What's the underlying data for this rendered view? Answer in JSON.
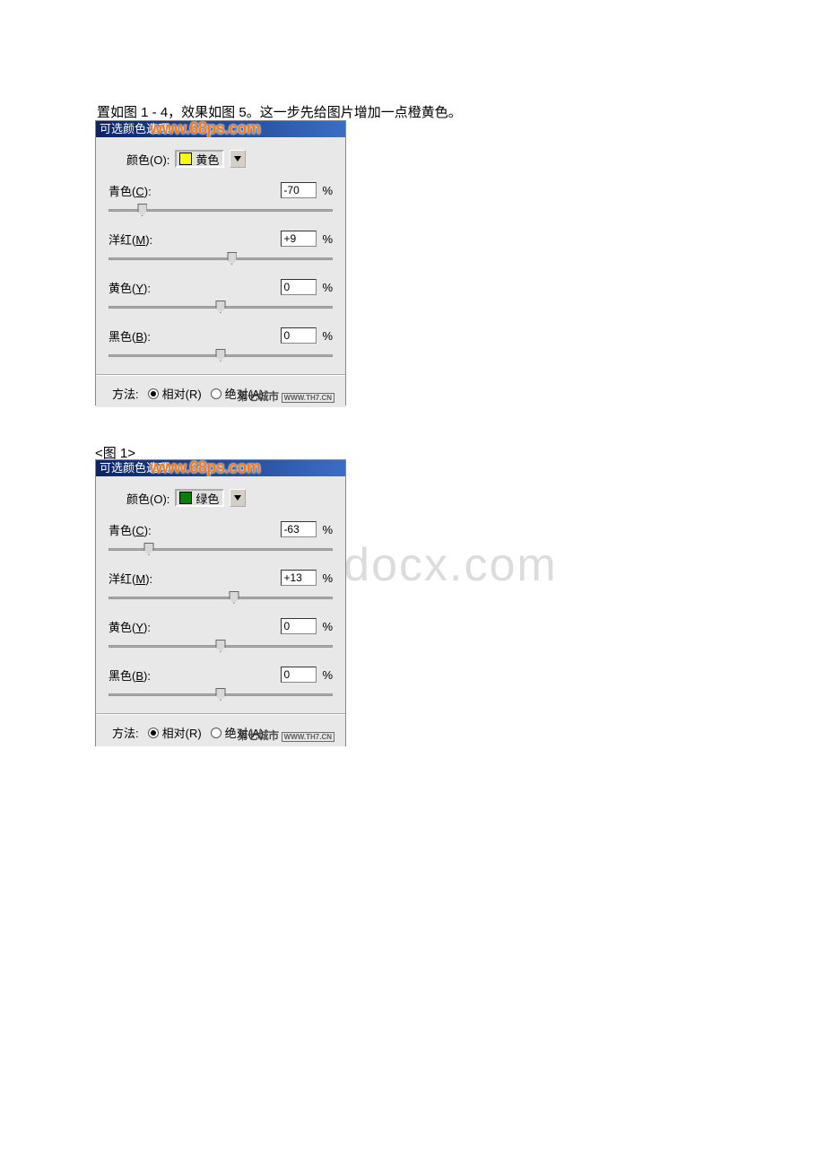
{
  "caption_top": "置如图 1 - 4，效果如图 5。这一步先给图片增加一点橙黄色。",
  "figure_label": "<图 1>",
  "bg_watermark": "www.bdocx.com",
  "panels": [
    {
      "title": "可选颜色选项",
      "wm_overlay": "www.68ps.com",
      "color_label": "颜色(O):",
      "color_letter": "O",
      "selected_color": "黄色",
      "swatch_class": "yellow",
      "sliders": [
        {
          "label": "青色",
          "letter": "C",
          "value": "-70",
          "pct": "%",
          "pos": 15
        },
        {
          "label": "洋红",
          "letter": "M",
          "value": "+9",
          "pct": "%",
          "pos": 55
        },
        {
          "label": "黄色",
          "letter": "Y",
          "value": "0",
          "pct": "%",
          "pos": 50
        },
        {
          "label": "黑色",
          "letter": "B",
          "value": "0",
          "pct": "%",
          "pos": 50
        }
      ],
      "method_label": "方法:",
      "radio1": "相对(R)",
      "radio2": "绝对(A)",
      "wm_bottom_main": "第七城市",
      "wm_bottom_mini": "WWW.TH7.CN"
    },
    {
      "title": "可选颜色选项",
      "wm_overlay": "www.68ps.com",
      "color_label": "颜色(O):",
      "color_letter": "O",
      "selected_color": "绿色",
      "swatch_class": "green",
      "sliders": [
        {
          "label": "青色",
          "letter": "C",
          "value": "-63",
          "pct": "%",
          "pos": 18
        },
        {
          "label": "洋红",
          "letter": "M",
          "value": "+13",
          "pct": "%",
          "pos": 56
        },
        {
          "label": "黄色",
          "letter": "Y",
          "value": "0",
          "pct": "%",
          "pos": 50
        },
        {
          "label": "黑色",
          "letter": "B",
          "value": "0",
          "pct": "%",
          "pos": 50
        }
      ],
      "method_label": "方法:",
      "radio1": "相对(R)",
      "radio2": "绝对(A)",
      "wm_bottom_main": "第七城市",
      "wm_bottom_mini": "WWW.TH7.CN"
    }
  ]
}
